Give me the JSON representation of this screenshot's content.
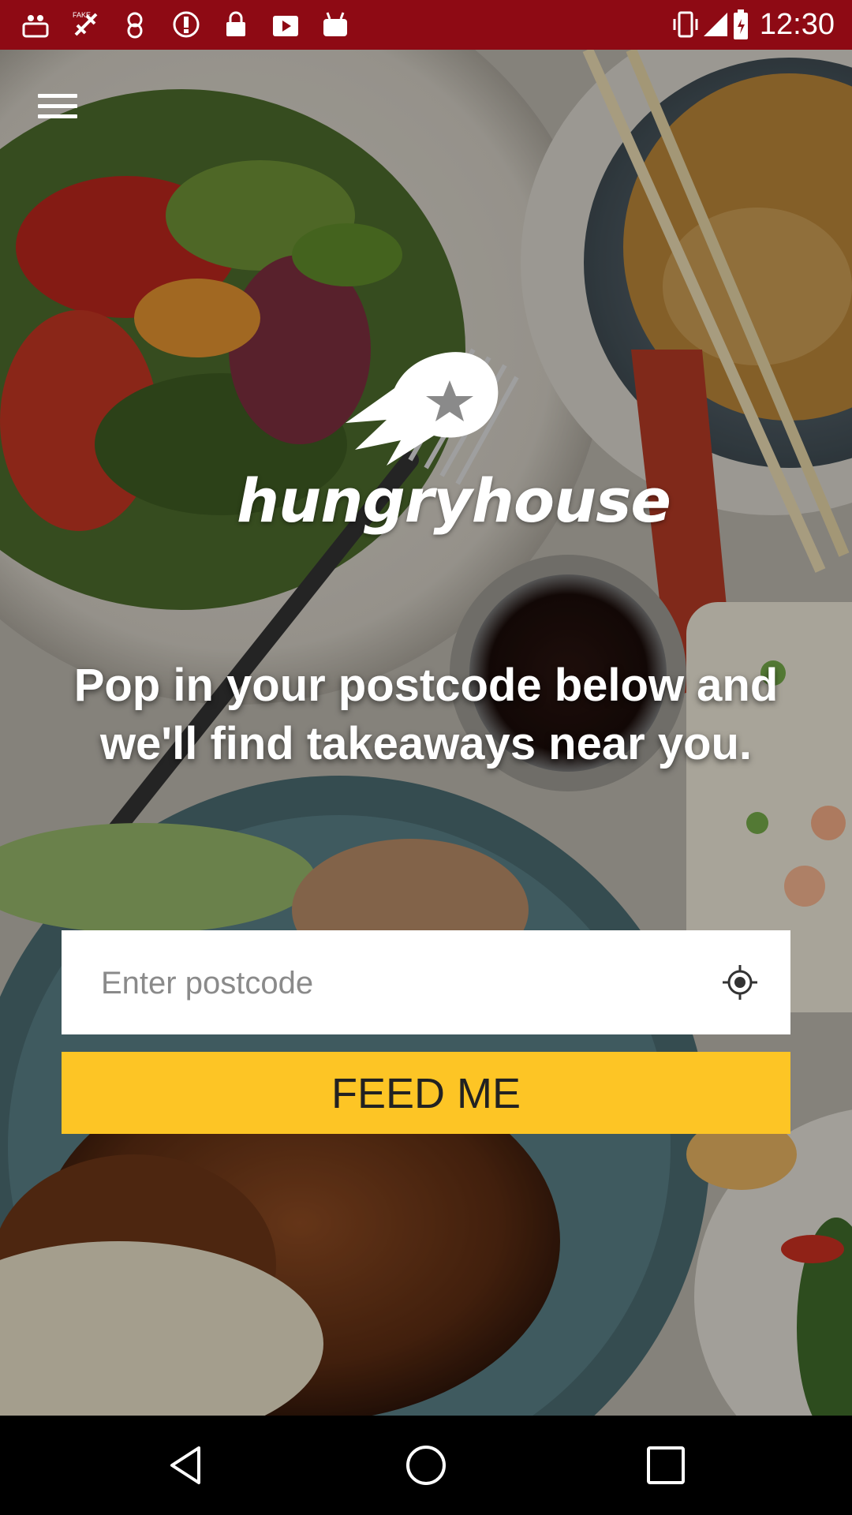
{
  "status_bar": {
    "time": "12:30",
    "left_icons": [
      "assistant-icon",
      "fake-gps-icon",
      "timer-icon",
      "info-icon",
      "lock-icon",
      "play-store-icon",
      "bag-icon"
    ],
    "right_icons": [
      "vibrate-icon",
      "signal-icon",
      "battery-icon"
    ],
    "background_color": "#8e0a14"
  },
  "header": {
    "menu_icon": "hamburger-menu-icon"
  },
  "logo": {
    "wordmark": "hungryhouse",
    "mark_icon": "shooting-star-icon"
  },
  "main": {
    "headline": "Pop in your postcode below and we'll find takeaways near you.",
    "postcode_input": {
      "placeholder": "Enter postcode",
      "value": ""
    },
    "locate_icon": "gps-target-icon",
    "submit_label": "FEED ME",
    "submit_color": "#fdc525"
  },
  "nav_bar": {
    "buttons": [
      "back-icon",
      "home-icon",
      "recents-icon"
    ]
  }
}
